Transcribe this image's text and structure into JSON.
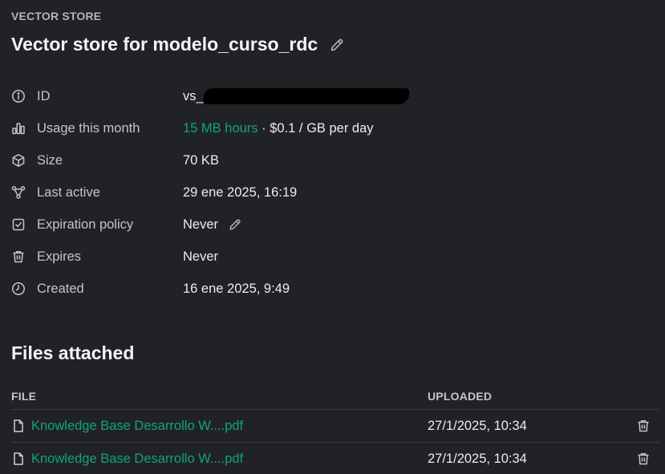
{
  "header": {
    "section_label": "VECTOR STORE",
    "title": "Vector store for modelo_curso_rdc"
  },
  "properties": [
    {
      "icon": "info-icon",
      "label": "ID",
      "value": "vs_"
    },
    {
      "icon": "bar-chart-icon",
      "label": "Usage this month",
      "value_accent": "15 MB hours",
      "value_rest": " · $0.1 / GB per day"
    },
    {
      "icon": "cube-icon",
      "label": "Size",
      "value": "70 KB"
    },
    {
      "icon": "nodes-icon",
      "label": "Last active",
      "value": "29 ene 2025, 16:19"
    },
    {
      "icon": "calendar-check-icon",
      "label": "Expiration policy",
      "value": "Never"
    },
    {
      "icon": "trash-icon",
      "label": "Expires",
      "value": "Never"
    },
    {
      "icon": "clock-icon",
      "label": "Created",
      "value": "16 ene 2025, 9:49"
    }
  ],
  "files": {
    "title": "Files attached",
    "columns": {
      "file": "FILE",
      "uploaded": "UPLOADED"
    },
    "rows": [
      {
        "name": "Knowledge Base Desarrollo W....pdf",
        "uploaded": "27/1/2025, 10:34"
      },
      {
        "name": "Knowledge Base Desarrollo W....pdf",
        "uploaded": "27/1/2025, 10:34"
      }
    ]
  },
  "colors": {
    "background": "#212225",
    "accent": "#10a37f",
    "text": "#ececec",
    "muted": "#c5c5c5"
  }
}
